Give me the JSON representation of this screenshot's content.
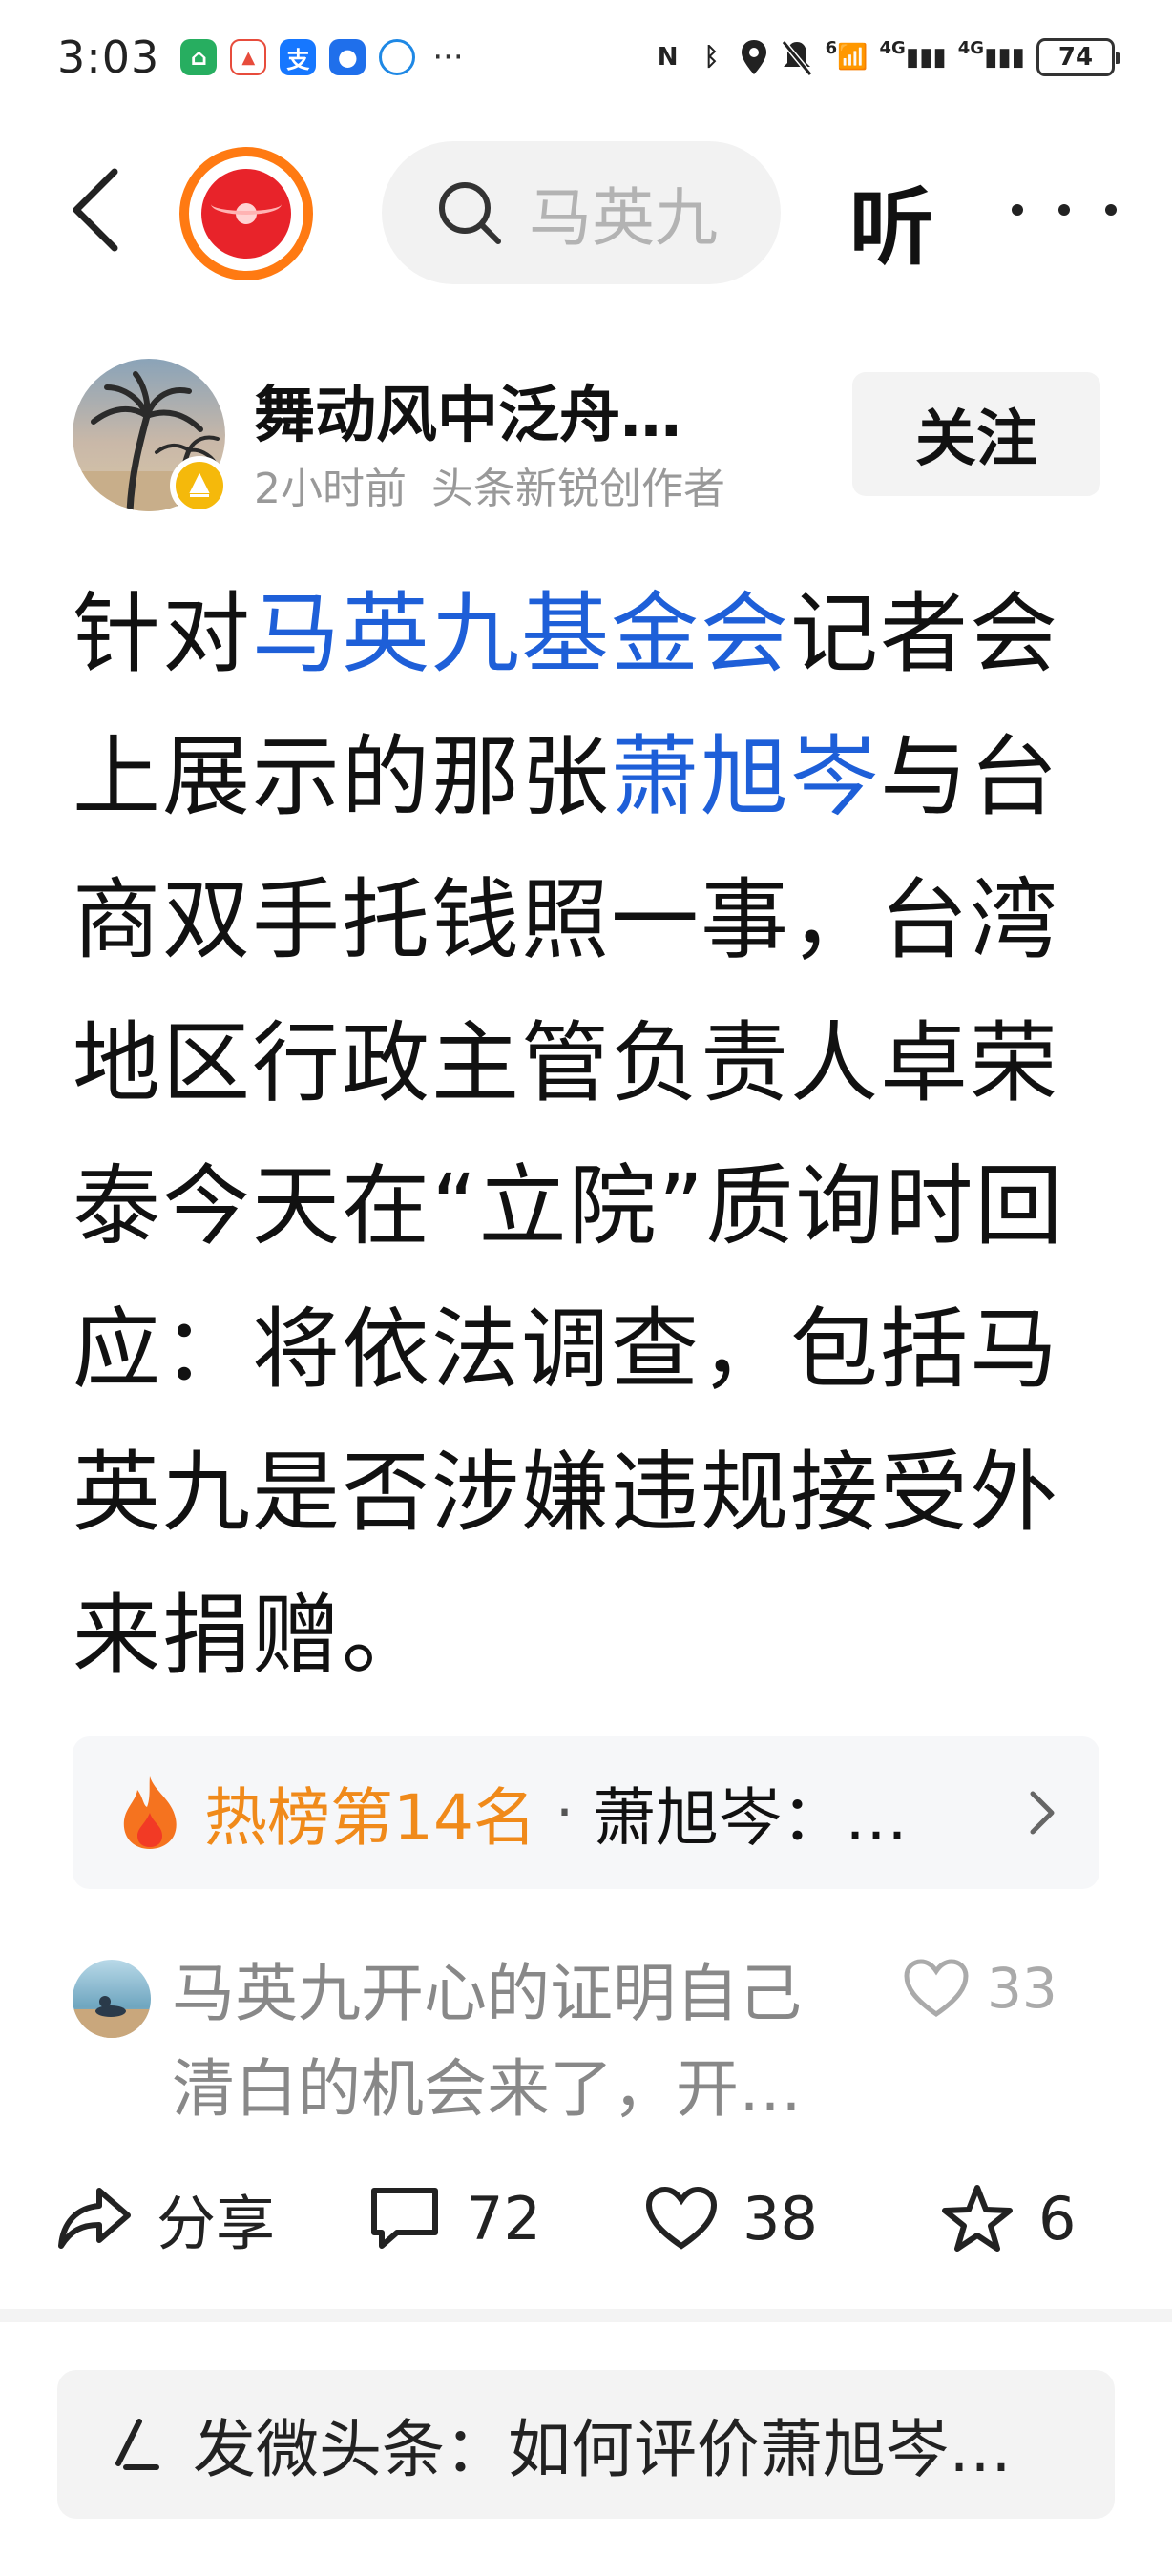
{
  "status_bar": {
    "time": "3:03",
    "more": "···",
    "signal_1": "4G",
    "signal_2": "4G",
    "wifi_badge": "6",
    "battery": "74"
  },
  "nav": {
    "search_placeholder": "马英九",
    "listen_label": "听"
  },
  "author": {
    "name": "舞动风中泛舟…",
    "time": "2小时前",
    "title": "头条新锐创作者",
    "follow_label": "关注"
  },
  "post": {
    "segments": [
      {
        "text": "针对",
        "link": false
      },
      {
        "text": "马英九基金会",
        "link": true
      },
      {
        "text": "记者会上展示的那张",
        "link": false
      },
      {
        "text": "萧旭岑",
        "link": true
      },
      {
        "text": "与台商双手托钱照一事，台湾地区行政主管负责人卓荣泰今天在“立院”质询时回应：将依法调查，包括马英九是否涉嫌违规接受外来捐赠。",
        "link": false
      }
    ]
  },
  "hot_rank": {
    "rank_label": "热榜第14名",
    "separator": "·",
    "topic": "萧旭岑：…"
  },
  "comment_preview": {
    "text": "马英九开心的证明自己清白的机会来了，开…",
    "likes": "33"
  },
  "actions": {
    "share_label": "分享",
    "comments_count": "72",
    "likes_count": "38",
    "favorites_count": "6"
  },
  "compose": {
    "text": "发微头条：如何评价萧旭岑…"
  },
  "colors": {
    "link": "#1e5fd8",
    "hot": "#f08a1a",
    "redpacket_ring": "#ff7a12",
    "redpacket": "#e8232a"
  },
  "icons": [
    "back-icon",
    "redpacket-icon",
    "search-icon",
    "more-icon",
    "creator-badge-icon",
    "flame-icon",
    "chevron-right-icon",
    "heart-icon",
    "share-icon",
    "comment-icon",
    "star-icon",
    "pen-icon"
  ]
}
